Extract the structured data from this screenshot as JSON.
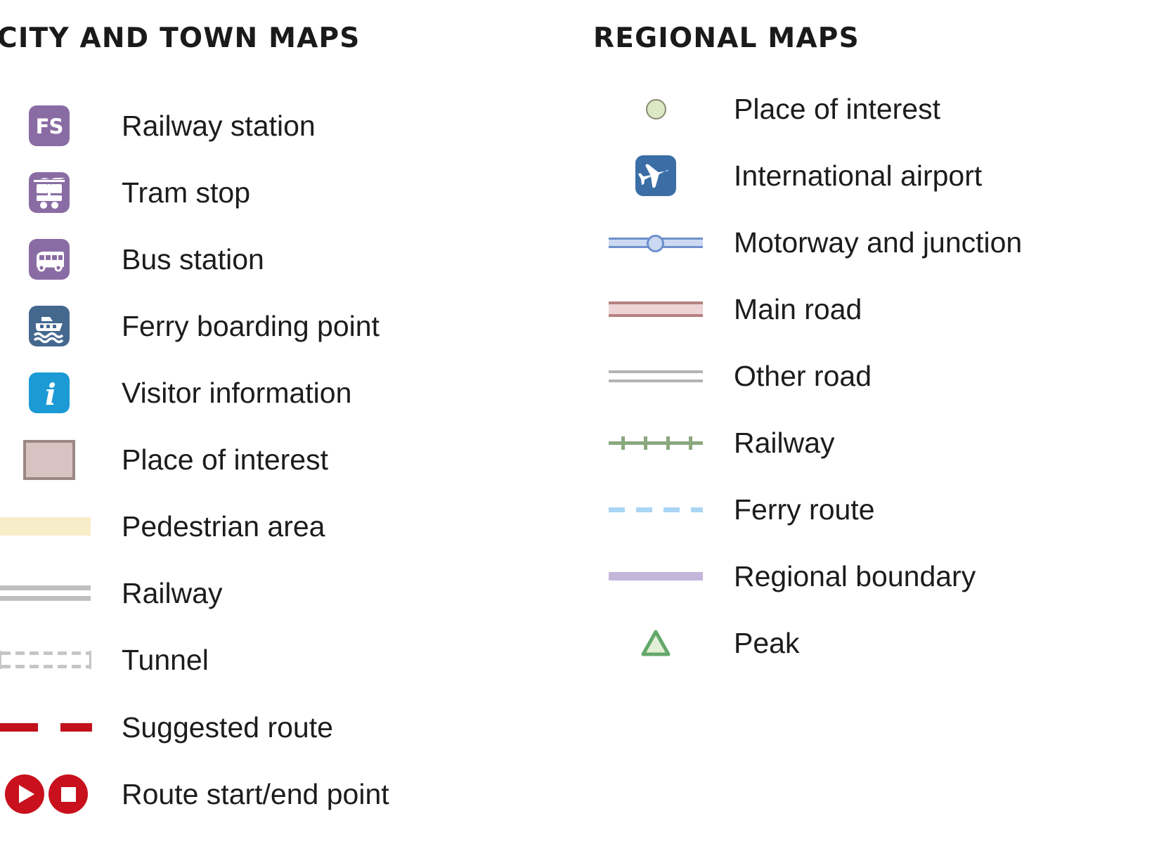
{
  "sections": [
    {
      "id": "city-and-town-maps",
      "title": "CITY AND TOWN MAPS",
      "items": [
        {
          "symbol": "railway-station-icon",
          "label": "Railway station"
        },
        {
          "symbol": "tram-stop-icon",
          "label": "Tram stop"
        },
        {
          "symbol": "bus-station-icon",
          "label": "Bus station"
        },
        {
          "symbol": "ferry-boarding-icon",
          "label": "Ferry boarding point"
        },
        {
          "symbol": "visitor-information-icon",
          "label": "Visitor information"
        },
        {
          "symbol": "place-of-interest-swatch",
          "label": "Place of interest"
        },
        {
          "symbol": "pedestrian-area-swatch",
          "label": "Pedestrian area"
        },
        {
          "symbol": "railway-line",
          "label": "Railway"
        },
        {
          "symbol": "tunnel-line",
          "label": "Tunnel"
        },
        {
          "symbol": "suggested-route-line",
          "label": "Suggested route"
        },
        {
          "symbol": "route-endpoints-icon",
          "label": "Route start/end point"
        }
      ]
    },
    {
      "id": "regional-maps",
      "title": "REGIONAL MAPS",
      "items": [
        {
          "symbol": "place-of-interest-dot",
          "label": "Place of interest"
        },
        {
          "symbol": "international-airport-icon",
          "label": "International airport"
        },
        {
          "symbol": "motorway-junction-line",
          "label": "Motorway and junction"
        },
        {
          "symbol": "main-road-line",
          "label": "Main road"
        },
        {
          "symbol": "other-road-line",
          "label": "Other road"
        },
        {
          "symbol": "railway-line-regional",
          "label": "Railway"
        },
        {
          "symbol": "ferry-route-line",
          "label": "Ferry route"
        },
        {
          "symbol": "regional-boundary-line",
          "label": "Regional boundary"
        },
        {
          "symbol": "peak-icon",
          "label": "Peak"
        }
      ]
    }
  ],
  "icon_glyphs": {
    "railway_station_text": "FS"
  },
  "colors": {
    "transport_purple": "#8a6ca4",
    "ferry_blue": "#45688f",
    "information_blue": "#1b9ad6",
    "airport_blue": "#3b6ea5",
    "place_of_interest_fill": "#d8c2c2",
    "place_of_interest_border": "#9b8884",
    "pedestrian_area": "#f7eec9",
    "railway_grey": "#bfbfbf",
    "tunnel_grey": "#c6c6c6",
    "route_red": "#c1121c",
    "regional_poi_green": "#dbe8c4",
    "motorway_fill": "#ccd9f2",
    "motorway_stroke": "#6d90cc",
    "main_road_fill": "#eed5d5",
    "main_road_stroke": "#b5817f",
    "other_road_stroke": "#b3b3b3",
    "regional_railway_green": "#8aa87e",
    "ferry_route_blue": "#aad5f5",
    "regional_boundary_purple": "#c3b6da",
    "peak_green": "#63a86a",
    "peak_fill": "#e2efd6",
    "text": "#1c1c1c"
  }
}
